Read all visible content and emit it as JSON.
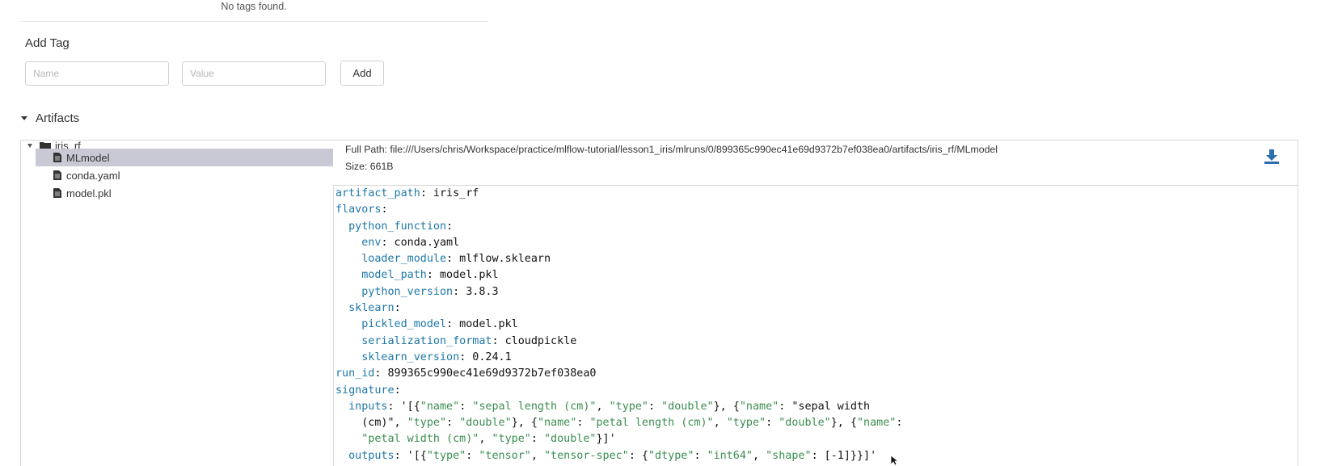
{
  "tags": {
    "empty_text": "No tags found.",
    "add_tag_title": "Add Tag",
    "name_placeholder": "Name",
    "value_placeholder": "Value",
    "add_button": "Add"
  },
  "artifacts": {
    "title": "Artifacts",
    "tree": {
      "folder": "iris_rf",
      "files": [
        "MLmodel",
        "conda.yaml",
        "model.pkl"
      ],
      "selected": "MLmodel"
    },
    "full_path_label": "Full Path:",
    "full_path": "file:///Users/chris/Workspace/practice/mlflow-tutorial/lesson1_iris/mlruns/0/899365c990ec41e69d9372b7ef038ea0/artifacts/iris_rf/MLmodel",
    "size_label": "Size:",
    "size": "661B",
    "icons": {
      "download": "download-icon",
      "folder": "folder-icon",
      "file": "file-icon",
      "tree_toggle": "caret-down-icon",
      "section_toggle": "caret-down-icon"
    },
    "code_lines": [
      [
        {
          "t": "artifact_path",
          "c": "k"
        },
        {
          "t": ": iris_rf",
          "c": ""
        }
      ],
      [
        {
          "t": "flavors",
          "c": "k"
        },
        {
          "t": ":",
          "c": ""
        }
      ],
      [
        {
          "t": "  ",
          "c": ""
        },
        {
          "t": "python_function",
          "c": "k"
        },
        {
          "t": ":",
          "c": ""
        }
      ],
      [
        {
          "t": "    ",
          "c": ""
        },
        {
          "t": "env",
          "c": "k"
        },
        {
          "t": ": conda.yaml",
          "c": ""
        }
      ],
      [
        {
          "t": "    ",
          "c": ""
        },
        {
          "t": "loader_module",
          "c": "k"
        },
        {
          "t": ": mlflow.sklearn",
          "c": ""
        }
      ],
      [
        {
          "t": "    ",
          "c": ""
        },
        {
          "t": "model_path",
          "c": "k"
        },
        {
          "t": ": model.pkl",
          "c": ""
        }
      ],
      [
        {
          "t": "    ",
          "c": ""
        },
        {
          "t": "python_version",
          "c": "k"
        },
        {
          "t": ": 3.8.3",
          "c": ""
        }
      ],
      [
        {
          "t": "  ",
          "c": ""
        },
        {
          "t": "sklearn",
          "c": "k"
        },
        {
          "t": ":",
          "c": ""
        }
      ],
      [
        {
          "t": "    ",
          "c": ""
        },
        {
          "t": "pickled_model",
          "c": "k"
        },
        {
          "t": ": model.pkl",
          "c": ""
        }
      ],
      [
        {
          "t": "    ",
          "c": ""
        },
        {
          "t": "serialization_format",
          "c": "k"
        },
        {
          "t": ": cloudpickle",
          "c": ""
        }
      ],
      [
        {
          "t": "    ",
          "c": ""
        },
        {
          "t": "sklearn_version",
          "c": "k"
        },
        {
          "t": ": 0.24.1",
          "c": ""
        }
      ],
      [
        {
          "t": "run_id",
          "c": "k"
        },
        {
          "t": ": 899365c990ec41e69d9372b7ef038ea0",
          "c": ""
        }
      ],
      [
        {
          "t": "signature",
          "c": "k"
        },
        {
          "t": ":",
          "c": ""
        }
      ],
      [
        {
          "t": "  ",
          "c": ""
        },
        {
          "t": "inputs",
          "c": "k"
        },
        {
          "t": ": '[{",
          "c": ""
        },
        {
          "t": "\"name\"",
          "c": "s"
        },
        {
          "t": ": ",
          "c": ""
        },
        {
          "t": "\"sepal length (cm)\"",
          "c": "s"
        },
        {
          "t": ", ",
          "c": ""
        },
        {
          "t": "\"type\"",
          "c": "s"
        },
        {
          "t": ": ",
          "c": ""
        },
        {
          "t": "\"double\"",
          "c": "s"
        },
        {
          "t": "}, {",
          "c": ""
        },
        {
          "t": "\"name\"",
          "c": "s"
        },
        {
          "t": ": \"sepal width",
          "c": ""
        }
      ],
      [
        {
          "t": "    (cm)\", ",
          "c": ""
        },
        {
          "t": "\"type\"",
          "c": "s"
        },
        {
          "t": ": ",
          "c": ""
        },
        {
          "t": "\"double\"",
          "c": "s"
        },
        {
          "t": "}, {",
          "c": ""
        },
        {
          "t": "\"name\"",
          "c": "s"
        },
        {
          "t": ": ",
          "c": ""
        },
        {
          "t": "\"petal length (cm)\"",
          "c": "s"
        },
        {
          "t": ", ",
          "c": ""
        },
        {
          "t": "\"type\"",
          "c": "s"
        },
        {
          "t": ": ",
          "c": ""
        },
        {
          "t": "\"double\"",
          "c": "s"
        },
        {
          "t": "}, {",
          "c": ""
        },
        {
          "t": "\"name\"",
          "c": "s"
        },
        {
          "t": ":",
          "c": ""
        }
      ],
      [
        {
          "t": "    ",
          "c": ""
        },
        {
          "t": "\"petal width (cm)\"",
          "c": "s"
        },
        {
          "t": ", ",
          "c": ""
        },
        {
          "t": "\"type\"",
          "c": "s"
        },
        {
          "t": ": ",
          "c": ""
        },
        {
          "t": "\"double\"",
          "c": "s"
        },
        {
          "t": "}]'",
          "c": ""
        }
      ],
      [
        {
          "t": "  ",
          "c": ""
        },
        {
          "t": "outputs",
          "c": "k"
        },
        {
          "t": ": '[{",
          "c": ""
        },
        {
          "t": "\"type\"",
          "c": "s"
        },
        {
          "t": ": ",
          "c": ""
        },
        {
          "t": "\"tensor\"",
          "c": "s"
        },
        {
          "t": ", ",
          "c": ""
        },
        {
          "t": "\"tensor-spec\"",
          "c": "s"
        },
        {
          "t": ": {",
          "c": ""
        },
        {
          "t": "\"dtype\"",
          "c": "s"
        },
        {
          "t": ": ",
          "c": ""
        },
        {
          "t": "\"int64\"",
          "c": "s"
        },
        {
          "t": ", ",
          "c": ""
        },
        {
          "t": "\"shape\"",
          "c": "s"
        },
        {
          "t": ": [-1]}}]'",
          "c": ""
        }
      ]
    ]
  }
}
